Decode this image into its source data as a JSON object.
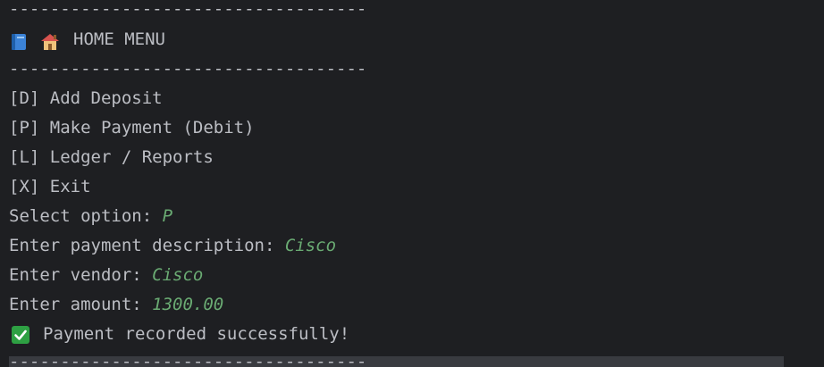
{
  "console": {
    "separator": "-----------------------------------",
    "menu": {
      "title": "HOME MENU",
      "icons": [
        "book-icon",
        "house-icon"
      ],
      "options": [
        {
          "key": "[D]",
          "label": "Add Deposit"
        },
        {
          "key": "[P]",
          "label": "Make Payment (Debit)"
        },
        {
          "key": "[L]",
          "label": "Ledger / Reports"
        },
        {
          "key": "[X]",
          "label": "Exit"
        }
      ]
    },
    "prompts": [
      {
        "prompt": "Select option: ",
        "value": "P"
      },
      {
        "prompt": "Enter payment description: ",
        "value": "Cisco"
      },
      {
        "prompt": "Enter vendor: ",
        "value": "Cisco"
      },
      {
        "prompt": "Enter amount: ",
        "value": "1300.00"
      }
    ],
    "status": {
      "icon": "check-icon",
      "message": "Payment recorded successfully!"
    }
  },
  "colors": {
    "background": "#1e1f22",
    "text": "#bcbec4",
    "input": "#6aab73",
    "check": "#2ea043",
    "selection": "#393b40"
  }
}
